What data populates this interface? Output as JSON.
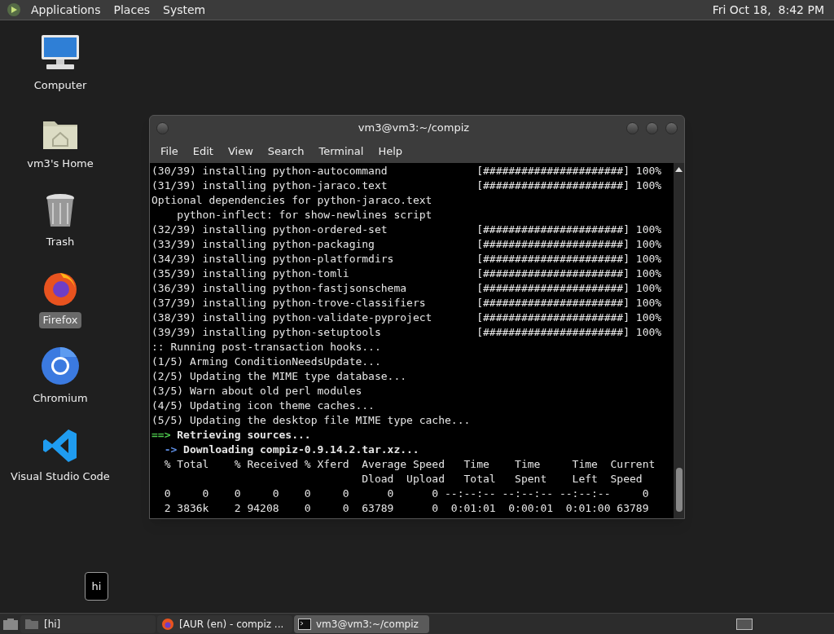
{
  "top_panel": {
    "menus": [
      "Applications",
      "Places",
      "System"
    ],
    "clock": "Fri Oct 18,  8:42 PM"
  },
  "desktop_icons": [
    {
      "kind": "computer",
      "label": "Computer",
      "selected": false
    },
    {
      "kind": "home",
      "label": "vm3's Home",
      "selected": false
    },
    {
      "kind": "trash",
      "label": "Trash",
      "selected": false
    },
    {
      "kind": "firefox",
      "label": "Firefox",
      "selected": true
    },
    {
      "kind": "chromium",
      "label": "Chromium",
      "selected": false
    },
    {
      "kind": "vscode",
      "label": "Visual Studio Code",
      "selected": false
    }
  ],
  "terminal": {
    "title": "vm3@vm3:~/compiz",
    "menus": [
      "File",
      "Edit",
      "View",
      "Search",
      "Terminal",
      "Help"
    ],
    "lines": [
      {
        "kind": "progress",
        "text": "(30/39) installing python-autocommand",
        "bar": "[######################]",
        "percent": "100%"
      },
      {
        "kind": "progress",
        "text": "(31/39) installing python-jaraco.text",
        "bar": "[######################]",
        "percent": "100%"
      },
      {
        "kind": "plain",
        "text": "Optional dependencies for python-jaraco.text"
      },
      {
        "kind": "plain",
        "text": "    python-inflect: for show-newlines script"
      },
      {
        "kind": "progress",
        "text": "(32/39) installing python-ordered-set",
        "bar": "[######################]",
        "percent": "100%"
      },
      {
        "kind": "progress",
        "text": "(33/39) installing python-packaging",
        "bar": "[######################]",
        "percent": "100%"
      },
      {
        "kind": "progress",
        "text": "(34/39) installing python-platformdirs",
        "bar": "[######################]",
        "percent": "100%"
      },
      {
        "kind": "progress",
        "text": "(35/39) installing python-tomli",
        "bar": "[######################]",
        "percent": "100%"
      },
      {
        "kind": "progress",
        "text": "(36/39) installing python-fastjsonschema",
        "bar": "[######################]",
        "percent": "100%"
      },
      {
        "kind": "progress",
        "text": "(37/39) installing python-trove-classifiers",
        "bar": "[######################]",
        "percent": "100%"
      },
      {
        "kind": "progress",
        "text": "(38/39) installing python-validate-pyproject",
        "bar": "[######################]",
        "percent": "100%"
      },
      {
        "kind": "progress",
        "text": "(39/39) installing python-setuptools",
        "bar": "[######################]",
        "percent": "100%"
      },
      {
        "kind": "plain",
        "text": ":: Running post-transaction hooks..."
      },
      {
        "kind": "plain",
        "text": "(1/5) Arming ConditionNeedsUpdate..."
      },
      {
        "kind": "plain",
        "text": "(2/5) Updating the MIME type database..."
      },
      {
        "kind": "plain",
        "text": "(3/5) Warn about old perl modules"
      },
      {
        "kind": "plain",
        "text": "(4/5) Updating icon theme caches..."
      },
      {
        "kind": "plain",
        "text": "(5/5) Updating the desktop file MIME type cache..."
      },
      {
        "kind": "heading",
        "marker": "==>",
        "text": "Retrieving sources..."
      },
      {
        "kind": "sub",
        "marker": "->",
        "text": "Downloading compiz-0.9.14.2.tar.xz..."
      },
      {
        "kind": "plain",
        "text": "  % Total    % Received % Xferd  Average Speed   Time    Time     Time  Current"
      },
      {
        "kind": "plain",
        "text": "                                 Dload  Upload   Total   Spent    Left  Speed"
      },
      {
        "kind": "plain",
        "text": "  0     0    0     0    0     0      0      0 --:--:-- --:--:-- --:--:--     0"
      },
      {
        "kind": "plain",
        "text": "  2 3836k    2 94208    0     0  63789      0  0:01:01  0:00:01  0:01:00 63789"
      }
    ]
  },
  "tooltip": "hi",
  "taskbar": {
    "tasks": [
      {
        "kind": "folder",
        "label": "[hi]",
        "selected": false
      },
      {
        "kind": "firefox",
        "label": "[AUR (en) - compiz ...",
        "selected": false
      },
      {
        "kind": "terminal",
        "label": "vm3@vm3:~/compiz",
        "selected": true
      }
    ]
  }
}
